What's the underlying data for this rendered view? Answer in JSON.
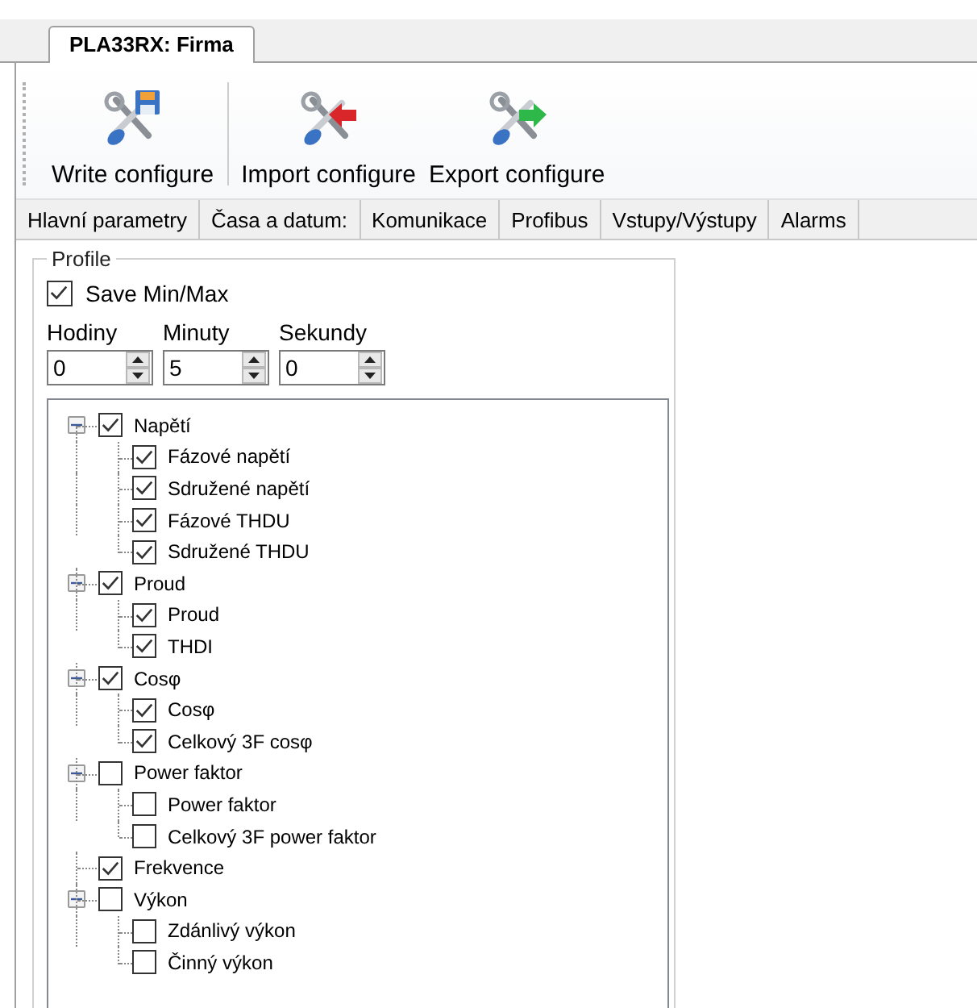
{
  "document_tab": {
    "title": "PLA33RX: Firma"
  },
  "toolbar": [
    {
      "kind": "write",
      "label": "Write configure"
    },
    {
      "kind": "import",
      "label": "Import configure"
    },
    {
      "kind": "export",
      "label": "Export configure"
    }
  ],
  "tabs": [
    "Hlavní parametry",
    "Časa a datum:",
    "Komunikace",
    "Profibus",
    "Vstupy/Výstupy",
    "Alarms"
  ],
  "profile": {
    "title": "Profile",
    "save_min_max": {
      "label": "Save Min/Max",
      "checked": true
    },
    "spinners": [
      {
        "label": "Hodiny",
        "value": "0"
      },
      {
        "label": "Minuty",
        "value": "5"
      },
      {
        "label": "Sekundy",
        "value": "0"
      }
    ],
    "tree": [
      {
        "label": "Napětí",
        "checked": true,
        "expanded": true,
        "children": [
          {
            "label": "Fázové napětí",
            "checked": true
          },
          {
            "label": "Sdružené napětí",
            "checked": true
          },
          {
            "label": "Fázové THDU",
            "checked": true
          },
          {
            "label": "Sdružené THDU",
            "checked": true
          }
        ]
      },
      {
        "label": "Proud",
        "checked": true,
        "expanded": true,
        "children": [
          {
            "label": "Proud",
            "checked": true
          },
          {
            "label": "THDI",
            "checked": true
          }
        ]
      },
      {
        "label": "Cosφ",
        "checked": true,
        "expanded": true,
        "children": [
          {
            "label": "Cosφ",
            "checked": true
          },
          {
            "label": "Celkový 3F cosφ",
            "checked": true
          }
        ]
      },
      {
        "label": "Power faktor",
        "checked": false,
        "expanded": true,
        "children": [
          {
            "label": "Power faktor",
            "checked": false
          },
          {
            "label": "Celkový 3F power faktor",
            "checked": false
          }
        ]
      },
      {
        "label": "Frekvence",
        "checked": true
      },
      {
        "label": "Výkon",
        "checked": false,
        "expanded": true,
        "children": [
          {
            "label": "Zdánlivý výkon",
            "checked": false
          },
          {
            "label": "Činný výkon",
            "checked": false
          }
        ]
      }
    ]
  }
}
